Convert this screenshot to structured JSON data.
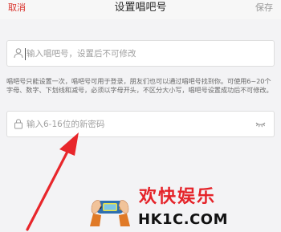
{
  "nav": {
    "cancel_label": "取消",
    "title": "设置唱吧号",
    "save_label": "保存"
  },
  "username_field": {
    "icon": "user-icon",
    "value": "",
    "placeholder": "输入唱吧号，设置后不可修改"
  },
  "hint_text": "唱吧号只能设置一次，唱吧号可用于登录，朋友们也可以通过唱吧号找到你。可使用6~20个字母、数字、下划线和减号，必须以字母开头，不区分大小写，唱吧号设置成功后不可修改。",
  "password_field": {
    "icon": "lock-icon",
    "value": "",
    "placeholder": "输入6-16位的新密码",
    "toggle_icon": "eye-closed-icon"
  },
  "watermark": {
    "title": "欢快娱乐",
    "site": "HK1C.COM"
  },
  "colors": {
    "accent": "#d9322b",
    "arrow": "#e8262b",
    "background": "#f3f3f5",
    "field_border": "#dedede"
  }
}
